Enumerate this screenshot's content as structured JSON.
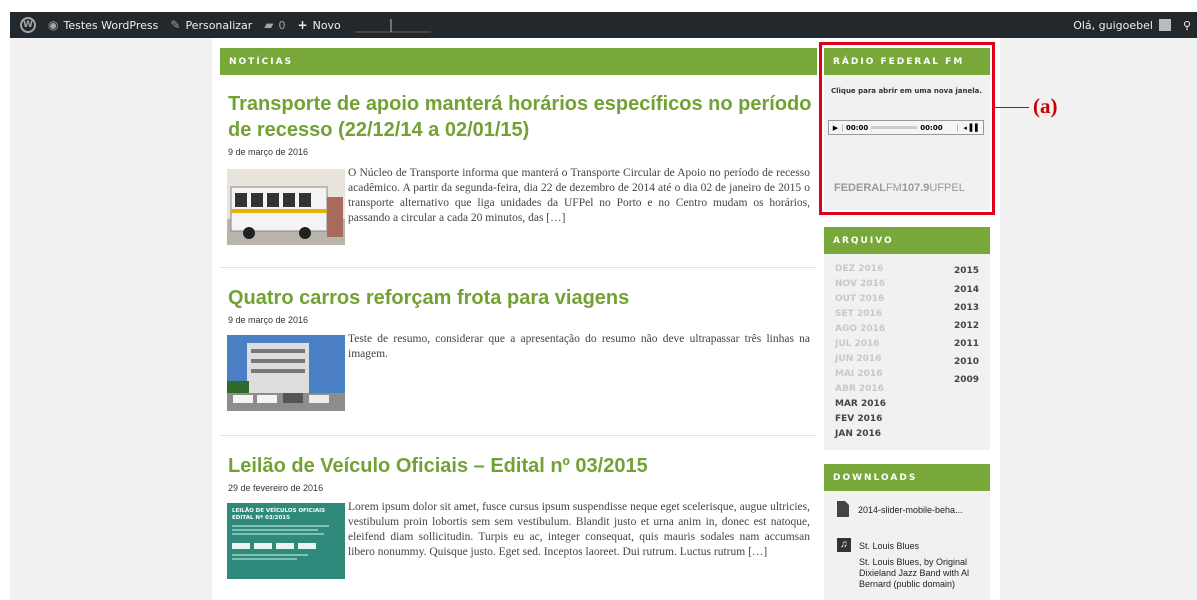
{
  "adminbar": {
    "site_name": "Testes WordPress",
    "customize": "Personalizar",
    "comments_count": "0",
    "new_label": "Novo",
    "greeting": "Olá, guigoebel"
  },
  "news_header": "NOTÍCIAS",
  "posts": [
    {
      "title": "Transporte de apoio manterá horários específicos no período de recesso (22/12/14 a 02/01/15)",
      "date": "9 de março de 2016",
      "excerpt": "O Núcleo de Transporte informa que manterá o Transporte Circular de Apoio no período de recesso acadêmico. A partir da segunda-feira, dia 22 de dezembro de 2014 até o dia 02 de janeiro de 2015 o transporte alternativo que liga unidades da UFPel no Porto e no Centro mudam os horários, passando a circular a cada 20 minutos, das […]"
    },
    {
      "title": "Quatro carros reforçam frota para viagens",
      "date": "9 de março de 2016",
      "excerpt": "Teste de resumo, considerar que a apresentação do resumo não deve ultrapassar três linhas na imagem."
    },
    {
      "title": "Leilão de Veículo Oficiais – Edital nº 03/2015",
      "date": "29 de fevereiro de 2016",
      "excerpt": "Lorem ipsum dolor sit amet, fusce cursus ipsum suspendisse neque eget scelerisque, augue ultricies, vestibulum proin lobortis sem sem vestibulum. Blandit justo et urna anim in, donec est natoque, eleifend diam sollicitudin. Turpis eu ac, integer consequat, quis mauris sodales nam accumsan libero nonummy. Quisque justo. Eget sed. Inceptos laoreet. Dui rutrum. Luctus rutrum […]",
      "thumb_title": "LEILÃO DE VEÍCULOS OFICIAIS EDITAL Nº 03/2015"
    }
  ],
  "radio": {
    "header": "RÁDIO FEDERAL FM",
    "note": "Clique para abrir em uma nova janela.",
    "time_current": "00:00",
    "time_total": "00:00",
    "logo_a": "FEDERAL",
    "logo_b": "FM",
    "logo_c": "107.9",
    "logo_d": "UFPEL"
  },
  "annotation": "(a)",
  "archive": {
    "header": "ARQUIVO",
    "months": [
      "DEZ 2016",
      "NOV 2016",
      "OUT 2016",
      "SET 2016",
      "AGO 2016",
      "JUL 2016",
      "JUN 2016",
      "MAI 2016",
      "ABR 2016",
      "MAR 2016",
      "FEV 2016",
      "JAN 2016"
    ],
    "years": [
      "2015",
      "2014",
      "2013",
      "2012",
      "2011",
      "2010",
      "2009"
    ]
  },
  "downloads": {
    "header": "DOWNLOADS",
    "file1": "2014-slider-mobile-beha...",
    "file2_title": "St. Louis Blues",
    "file2_desc": "St. Louis Blues, by Original Dixieland Jazz Band with Al Bernard (public domain)"
  },
  "colors": {
    "accent": "#78a83a",
    "title": "#72a134",
    "adminbar": "#23282d",
    "annotation": "#e0001b"
  }
}
